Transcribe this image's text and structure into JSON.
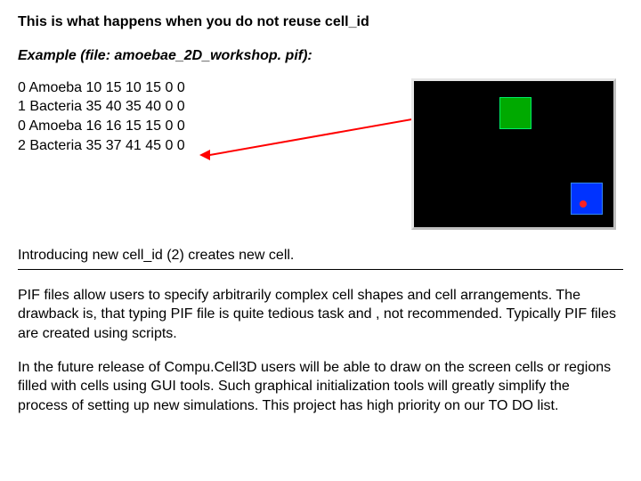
{
  "heading": "This is what happens when you do not reuse cell_id",
  "example_label": "Example (file: amoebae_2D_workshop. pif):",
  "pif_lines": [
    "0 Amoeba 10 15 10 15 0 0",
    "1 Bacteria 35 40 35 40 0 0",
    "0 Amoeba 16 16 15 15 0 0",
    "2 Bacteria 35 37 41 45 0 0"
  ],
  "caption": "Introducing new cell_id (2) creates new cell.",
  "para1": "PIF files allow users to specify arbitrarily complex cell shapes and cell arrangements. The drawback is, that typing PIF file is quite tedious task and , not recommended. Typically PIF files are created using scripts.",
  "para2": "In the future release of Compu.Cell3D users will be able to draw on the screen cells or regions filled with cells using GUI tools. Such graphical initialization tools will greatly simplify the process of setting up new simulations. This project has high priority on our TO DO list."
}
